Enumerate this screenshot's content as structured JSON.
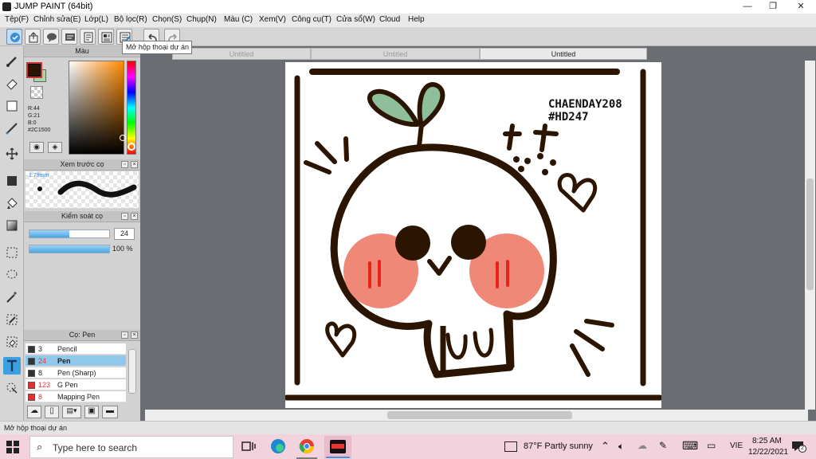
{
  "window": {
    "title": "JUMP PAINT (64bit)",
    "minimize": "—",
    "restore": "❐",
    "close": "✕"
  },
  "menu": [
    "Tệp(F)",
    "Chỉnh sửa(E)",
    "Lớp(L)",
    "Bộ lọc(R)",
    "Chọn(S)",
    "Chụp(N)",
    "Màu (C)",
    "Xem(V)",
    "Công cụ(T)",
    "Cửa sổ(W)",
    "Cloud",
    "Help"
  ],
  "toolbar": {
    "tooltip": "Mở hộp thoại dự án"
  },
  "doc_tabs": [
    "Untitled",
    "Untitled",
    "Untitled"
  ],
  "color_panel": {
    "title": "Màu",
    "r": "R:44",
    "g": "G:21",
    "b": "B:0",
    "hex": "#2C1500",
    "fg_color": "#2C1500"
  },
  "brush_preview": {
    "title": "Xem trước cọ",
    "size": "1.79mm"
  },
  "brush_control": {
    "title": "Kiểm soát cọ",
    "size_value": "24",
    "size_fraction": 0.5,
    "opacity_value": "100 %",
    "opacity_fraction": 1.0
  },
  "brush_list": {
    "title": "Cọ: Pen",
    "items": [
      {
        "size": "3",
        "name": "Pencil",
        "color": "#333333",
        "selected": false
      },
      {
        "size": "24",
        "name": "Pen",
        "color": "#333333",
        "selected": true
      },
      {
        "size": "8",
        "name": "Pen (Sharp)",
        "color": "#333333",
        "selected": false
      },
      {
        "size": "123",
        "name": "G Pen",
        "color": "#e03030",
        "selected": false
      },
      {
        "size": "8",
        "name": "Mapping Pen",
        "color": "#e03030",
        "selected": false
      }
    ]
  },
  "artwork": {
    "signature_line1": "CHAENDAY208",
    "signature_line2": "#HD247"
  },
  "status": {
    "text": "Mở hộp thoại dự án"
  },
  "taskbar": {
    "search_placeholder": "Type here to search",
    "weather": "87°F  Partly sunny",
    "language": "VIE",
    "time": "8:25 AM",
    "date": "12/22/2021",
    "notification_count": "2"
  },
  "colors": {
    "accent_blue": "#3aa0e0",
    "taskbar_pink": "#f1d2dd",
    "workspace_gray": "#6a6e73",
    "line_brown": "#2c1500",
    "blush": "#f08878",
    "sprout_green": "#8fbf9a"
  }
}
